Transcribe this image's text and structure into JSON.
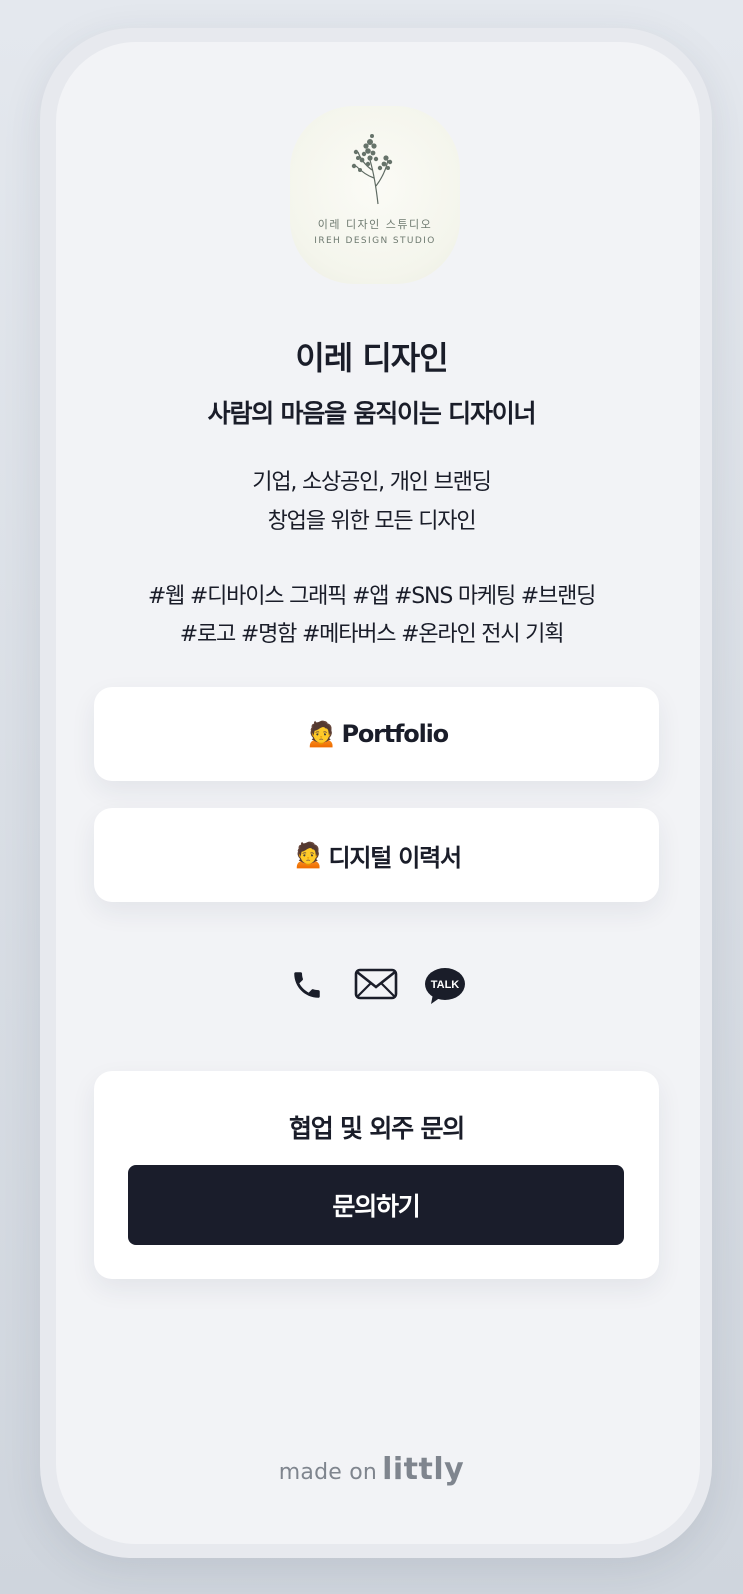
{
  "logo": {
    "korean_text": "이레 디자인 스튜디오",
    "english_text": "IREH DESIGN STUDIO",
    "icon": "flower-sprig-icon"
  },
  "profile": {
    "name": "이레 디자인",
    "tagline": "사람의 마음을 움직이는 디자이너",
    "description": [
      "기업, 소상공인, 개인 브랜딩",
      "창업을 위한 모든 디자인"
    ],
    "hashtags": [
      "#웹 #디바이스 그래픽 #앱 #SNS 마케팅 #브랜딩",
      "#로고 #명함 #메타버스 #온라인 전시 기획"
    ]
  },
  "links": [
    {
      "emoji": "🙍",
      "label": "Portfolio"
    },
    {
      "emoji": "🙍",
      "label": "디지털 이력서"
    }
  ],
  "contact_icons": [
    "phone-icon",
    "mail-icon",
    "kakao-talk-icon"
  ],
  "kakao_badge_text": "TALK",
  "inquiry": {
    "title": "협업 및 외주 문의",
    "button_label": "문의하기"
  },
  "footer": {
    "made_on": "made on",
    "brand": "littly"
  },
  "colors": {
    "text": "#1a1d29",
    "button_dark": "#1a1d2b",
    "page_bg": "#f2f3f6",
    "footer_text": "#7f858e"
  }
}
